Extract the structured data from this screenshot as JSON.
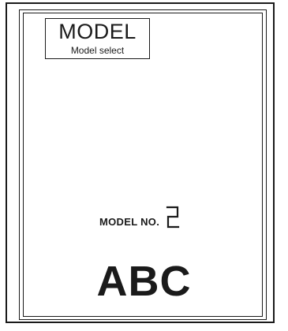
{
  "panel": {
    "title": "MODEL",
    "subtitle": "Model select"
  },
  "model_number": {
    "label": "MODEL NO.",
    "value": "2"
  },
  "display_text": "ABC"
}
